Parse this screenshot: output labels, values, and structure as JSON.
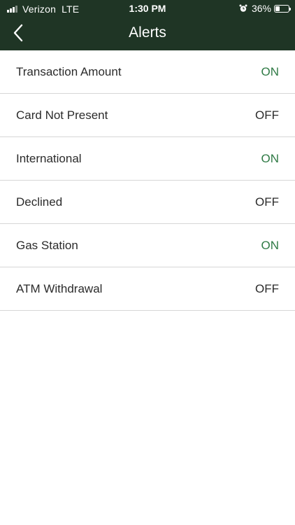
{
  "status_bar": {
    "carrier": "Verizon",
    "network": "LTE",
    "time": "1:30 PM",
    "battery_percent": "36%",
    "battery_level": 0.36,
    "signal_bars_filled": 3,
    "icons": [
      "signal-icon",
      "alarm-icon",
      "battery-icon"
    ]
  },
  "header": {
    "title": "Alerts",
    "back_icon": "chevron-left-icon",
    "background_color": "#1f3525"
  },
  "alerts": [
    {
      "label": "Transaction Amount",
      "value": "ON"
    },
    {
      "label": "Card Not Present",
      "value": "OFF"
    },
    {
      "label": "International",
      "value": "ON"
    },
    {
      "label": "Declined",
      "value": "OFF"
    },
    {
      "label": "Gas Station",
      "value": "ON"
    },
    {
      "label": "ATM Withdrawal",
      "value": "OFF"
    }
  ],
  "colors": {
    "on": "#2f7a45",
    "off": "#2b2b2b"
  }
}
